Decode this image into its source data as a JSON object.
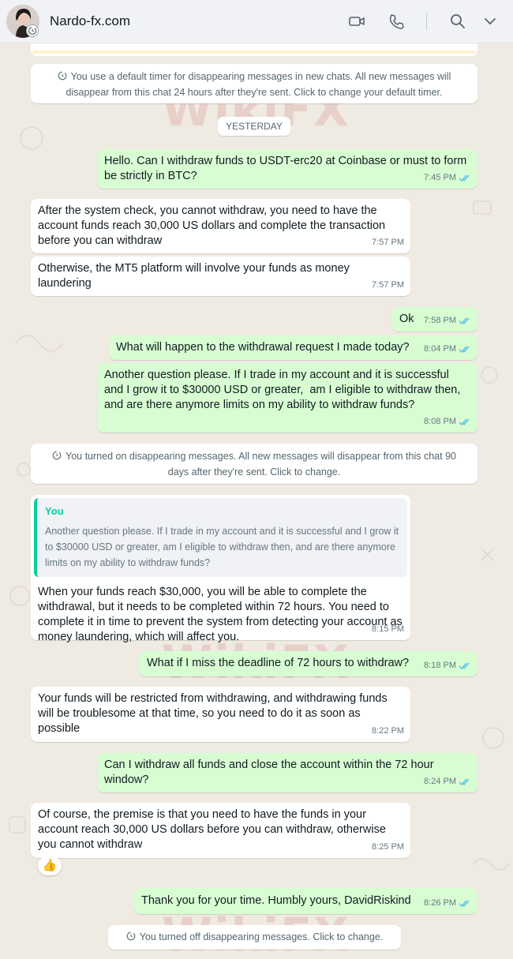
{
  "header": {
    "contact_name": "Nardo-fx.com",
    "icons": [
      "video-call-icon",
      "voice-call-icon",
      "search-icon",
      "chevron-down-icon"
    ]
  },
  "system_messages": {
    "default_timer": "You use a default timer for disappearing messages in new chats. All new messages will disappear from this chat 24 hours after they're sent. Click to change your default timer.",
    "turned_on": "You turned on disappearing messages. All new messages will disappear from this chat 90 days after they're sent. Click to change.",
    "turned_off": "You turned off disappearing messages. Click to change."
  },
  "date_divider": "YESTERDAY",
  "messages": [
    {
      "dir": "out",
      "text": "Hello. Can I withdraw funds to USDT-erc20 at Coinbase or must to form be strictly in BTC?",
      "time": "7:45 PM"
    },
    {
      "dir": "in",
      "text": "After the system check, you cannot withdraw, you need to have the account funds reach 30,000 US dollars and complete the transaction before you can withdraw",
      "time": "7:57 PM"
    },
    {
      "dir": "in",
      "text": "Otherwise, the MT5 platform will involve your funds as money laundering",
      "time": "7:57 PM"
    },
    {
      "dir": "out",
      "text": "Ok",
      "time": "7:58 PM"
    },
    {
      "dir": "out",
      "text": "What will happen to the withdrawal request I made today?",
      "time": "8:04 PM"
    },
    {
      "dir": "out",
      "text": "Another question please. If I trade in my account and it is successful and I grow it to $30000 USD or greater,  am I eligible to withdraw then, and are there anymore limits on my ability to withdraw funds?",
      "time": "8:08 PM"
    },
    {
      "dir": "in",
      "quote_author": "You",
      "quote_text": "Another question please. If I trade in my account and it is successful and I grow it to $30000 USD or greater,  am I eligible to withdraw then, and are there anymore limits on my ability to withdraw funds?",
      "text": "When your funds reach $30,000, you will be able to complete the withdrawal, but it needs to be completed within 72 hours. You need to complete it in time to prevent the system from detecting your account as money laundering, which will affect you.",
      "time": "8:15 PM"
    },
    {
      "dir": "out",
      "text": "What if I miss the deadline of 72 hours to withdraw?",
      "time": "8:18 PM"
    },
    {
      "dir": "in",
      "text": "Your funds will be restricted from withdrawing, and withdrawing funds will be troublesome at that time, so you need to do it as soon as possible",
      "time": "8:22 PM"
    },
    {
      "dir": "out",
      "text": "Can I withdraw all funds and close the account within the 72 hour window?",
      "time": "8:24 PM"
    },
    {
      "dir": "in",
      "text": "Of course, the premise is that you need to have the funds in your account reach 30,000 US dollars before you can withdraw, otherwise you cannot withdraw",
      "time": "8:25 PM",
      "reaction": "👍"
    },
    {
      "dir": "out",
      "text": "Thank you for your time. Humbly yours, DavidRiskind",
      "time": "8:26 PM"
    }
  ],
  "colors": {
    "incoming": "#ffffff",
    "outgoing": "#d9fdd3",
    "read_ticks": "#53bdeb",
    "quote_accent": "#06cf9c",
    "wallpaper": "#efeae2"
  },
  "watermark": "WikiFX"
}
